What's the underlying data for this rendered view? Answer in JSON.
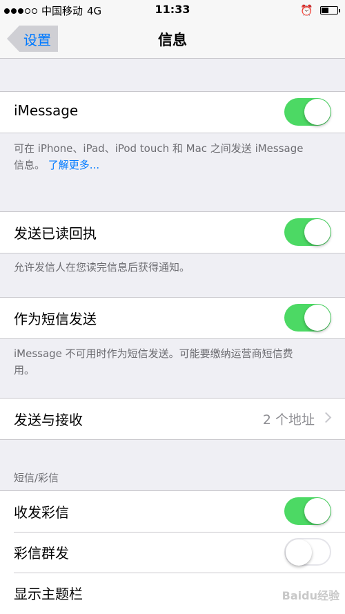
{
  "status_bar": {
    "carrier": "中国移动",
    "network": "4G",
    "time": "11:33"
  },
  "nav": {
    "back_label": "设置",
    "title": "信息"
  },
  "imessage": {
    "label": "iMessage",
    "on": true,
    "footer_text": "可在 iPhone、iPad、iPod touch 和 Mac 之间发送 iMessage 信息。",
    "footer_link": "了解更多..."
  },
  "read_receipts": {
    "label": "发送已读回执",
    "on": true,
    "footer_text": "允许发信人在您读完信息后获得通知。"
  },
  "send_as_sms": {
    "label": "作为短信发送",
    "on": true,
    "footer_text": "iMessage 不可用时作为短信发送。可能要缴纳运营商短信费用。"
  },
  "send_receive": {
    "label": "发送与接收",
    "value": "2 个地址"
  },
  "sms_mms": {
    "header": "短信/彩信",
    "mms_messaging": {
      "label": "收发彩信",
      "on": true
    },
    "group_messaging": {
      "label": "彩信群发",
      "on": false
    },
    "show_subject": {
      "label": "显示主题栏"
    }
  },
  "watermark": "Baidu经验",
  "colors": {
    "toggle_on": "#4cd964",
    "link": "#007aff",
    "background": "#efeff4"
  }
}
